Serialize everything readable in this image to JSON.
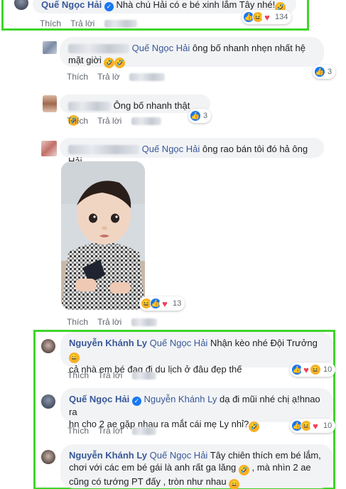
{
  "common": {
    "like_label": "Thích",
    "reply_label": "Trả lời",
    "reply_label_cut": "Trả lờ",
    "haha_emoji": "🤣",
    "laugh_emoji": "😄"
  },
  "comments": [
    {
      "author": "Quế Ngọc Hải",
      "text": "Nhà chú Hải có e bé xinh lắm Tây nhé!",
      "reaction_count": "134"
    },
    {
      "mention": "Quế Ngọc Hải",
      "text": "ông bố nhanh nhẹn nhất hệ mặt giời",
      "reaction_count": "3"
    },
    {
      "text": "Ông bố nhanh thật",
      "reaction_count": "3"
    },
    {
      "mention": "Quế Ngọc Hải",
      "text": "ông rao bán tôi đó hả ông Hải",
      "reaction_count": "13"
    },
    {
      "author": "Nguyễn Khánh Ly",
      "mention": "Quế Ngọc Hải",
      "text": "Nhận kèo nhé Đội Trưởng",
      "text2": "cả nhà em bé đag đi du lịch ở đâu đẹp thế",
      "reaction_count": "10"
    },
    {
      "author": "Quế Ngọc Hải",
      "mention": "Nguyễn Khánh Ly",
      "text": "dạ đi mũi nhé chị ạ!hnao ra",
      "text2": "hn cho 2 ae gặp nhau ra mắt cái mẹ Ly nhỉ?",
      "reaction_count": "10"
    },
    {
      "author": "Nguyễn Khánh Ly",
      "mention": "Quế Ngọc Hải",
      "text": "Tây chiên thích em bé lắm,",
      "text2": "chơi với các em bé gái là anh rất ga lăng",
      "text2b": ", mà nhìn 2 ae",
      "text3": "cũng có tướng PT đấy , tròn như nhau"
    }
  ],
  "colors": {
    "highlight": "#3fd52b",
    "link": "#385898",
    "bubble": "#f2f3f5"
  }
}
